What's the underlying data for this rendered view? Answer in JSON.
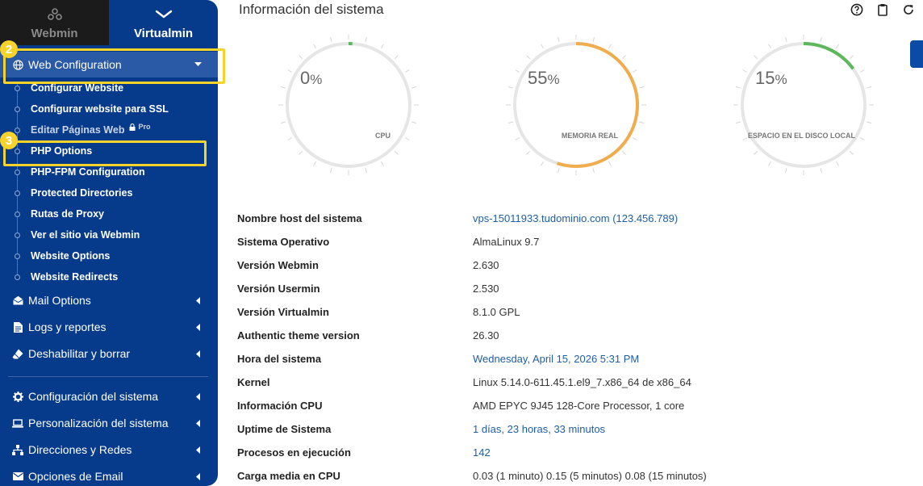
{
  "switcher": {
    "webmin": "Webmin",
    "virtualmin": "Virtualmin"
  },
  "steps": {
    "web_config": "2",
    "php_options": "3"
  },
  "sidebar": {
    "web_configuration": "Web Configuration",
    "subitems": [
      "Configurar Website",
      "Configurar website para SSL",
      "Editar Páginas Web",
      "PHP Options",
      "PHP-FPM Configuration",
      "Protected Directories",
      "Rutas de Proxy",
      "Ver el sitio via Webmin",
      "Website Options",
      "Website Redirects"
    ],
    "pro_label": "Pro",
    "sections": [
      "Mail Options",
      "Logs y reportes",
      "Deshabilitar y borrar",
      "Configuración del sistema",
      "Personalización del sistema",
      "Direcciones y Redes",
      "Opciones de Email"
    ]
  },
  "main": {
    "title": "Información del sistema",
    "gauges": [
      {
        "value": "0",
        "unit": "%",
        "label": "CPU",
        "percent": 0.01,
        "color": "#5cb85c"
      },
      {
        "value": "55",
        "unit": "%",
        "label": "MEMORIA REAL",
        "percent": 0.55,
        "color": "#f0ad4e"
      },
      {
        "value": "15",
        "unit": "%",
        "label": "ESPACIO EN EL DISCO LOCAL",
        "percent": 0.15,
        "color": "#5cb85c"
      }
    ],
    "info": [
      {
        "key": "Nombre host del sistema",
        "value": "vps-15011933.tudominio.com (123.456.789)",
        "link": true
      },
      {
        "key": "Sistema Operativo",
        "value": "AlmaLinux 9.7",
        "link": false
      },
      {
        "key": "Versión Webmin",
        "value": "2.630",
        "link": false
      },
      {
        "key": "Versión Usermin",
        "value": "2.530",
        "link": false
      },
      {
        "key": "Versión Virtualmin",
        "value": "8.1.0 GPL",
        "link": false
      },
      {
        "key": "Authentic theme version",
        "value": "26.30",
        "link": false
      },
      {
        "key": "Hora del sistema",
        "value": "Wednesday, April 15, 2026 5:31 PM",
        "link": true
      },
      {
        "key": "Kernel",
        "value": "Linux 5.14.0-611.45.1.el9_7.x86_64 de x86_64",
        "link": false
      },
      {
        "key": "Información CPU",
        "value": "AMD EPYC 9J45 128-Core Processor, 1 core",
        "link": false
      },
      {
        "key": "Uptime de Sistema",
        "value": "1 días, 23 horas, 33 minutos",
        "link": true
      },
      {
        "key": "Procesos en ejecución",
        "value": "142",
        "link": true
      },
      {
        "key": "Carga media en CPU",
        "value": "0.03 (1 minuto) 0.15 (5 minutos) 0.08 (15 minutos)",
        "link": false
      }
    ]
  }
}
